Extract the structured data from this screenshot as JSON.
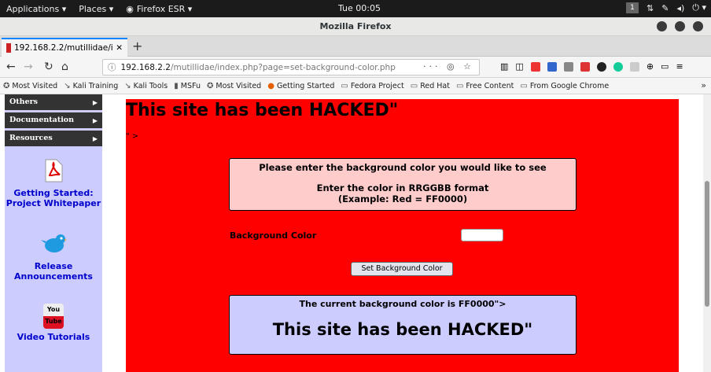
{
  "topbar": {
    "applications": "Applications ▾",
    "places": "Places ▾",
    "firefox": "Firefox ESR ▾",
    "clock": "Tue 00:05",
    "workspace": "1"
  },
  "window": {
    "title": "Mozilla Firefox"
  },
  "tab": {
    "label": "192.168.2.2/mutillidae/in"
  },
  "url": {
    "host": "192.168.2.2",
    "path": "/mutillidae/index.php?page=set-background-color.php"
  },
  "bookmarks": [
    "Most Visited",
    "Kali Training",
    "Kali Tools",
    "MSFu",
    "Most Visited",
    "Getting Started",
    "Fedora Project",
    "Red Hat",
    "Free Content",
    "From Google Chrome"
  ],
  "sidebar": {
    "items": [
      "Others",
      "Documentation",
      "Resources"
    ],
    "promos": [
      {
        "label": "Getting Started: Project Whitepaper",
        "icon": "pdf-icon"
      },
      {
        "label": "Release Announcements",
        "icon": "twitter-bird-icon"
      },
      {
        "label": "Video Tutorials",
        "icon": "youtube-icon",
        "icon_text": "You Tube"
      }
    ]
  },
  "main": {
    "hacked_title": "This site has been HACKED\"",
    "fragment": "\" >",
    "instructions": [
      "Please enter the background color you would like to see",
      "Enter the color in RRGGBB format",
      "(Example: Red = FF0000)"
    ],
    "field_label": "Background Color",
    "input_value": "",
    "button": "Set Background Color",
    "current_color": "The current background color is FF0000\">",
    "hacked_big": "This site has been HACKED\""
  },
  "colors": {
    "page_background": "#ff0000",
    "sidebar": "#ccccff",
    "info_box": "#ffcccc"
  }
}
